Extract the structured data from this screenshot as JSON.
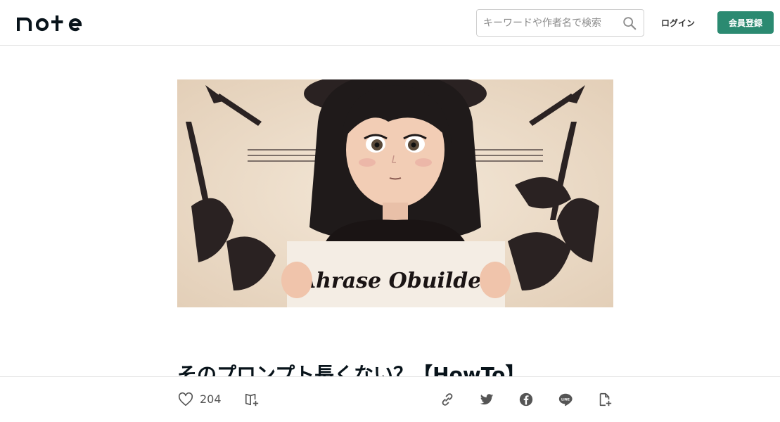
{
  "header": {
    "logo_text": "note",
    "search_placeholder": "キーワードや作者名で検索",
    "login_label": "ログイン",
    "signup_label": "会員登録"
  },
  "article": {
    "title": "そのプロンプト長くない？【HowTo】",
    "sign_text": "Ahrase Obuilder"
  },
  "actions": {
    "like_count": "204"
  },
  "colors": {
    "accent": "#2b8a71",
    "text": "#08131a",
    "icon": "#555555"
  }
}
